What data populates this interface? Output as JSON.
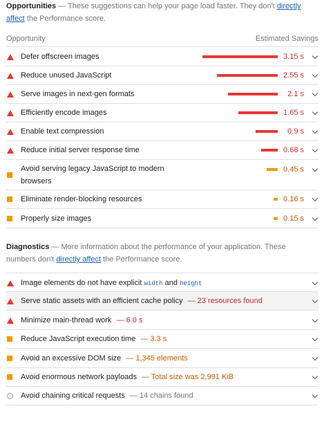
{
  "opportunities": {
    "title": "Opportunities",
    "dash": "—",
    "desc_before": "These suggestions can help your page load faster. They don't",
    "link": "directly affect",
    "desc_after": "the Performance score.",
    "col_left": "Opportunity",
    "col_right": "Estimated Savings",
    "items": [
      {
        "label": "Defer offscreen images",
        "savings": "3.15 s",
        "severity": "fail",
        "bar_fraction": 1.0
      },
      {
        "label": "Reduce unused JavaScript",
        "savings": "2.55 s",
        "severity": "fail",
        "bar_fraction": 0.81
      },
      {
        "label": "Serve images in next-gen formats",
        "savings": "2.1 s",
        "severity": "fail",
        "bar_fraction": 0.67
      },
      {
        "label": "Efficiently encode images",
        "savings": "1.65 s",
        "severity": "fail",
        "bar_fraction": 0.52
      },
      {
        "label": "Enable text compression",
        "savings": "0.9 s",
        "severity": "fail",
        "bar_fraction": 0.29
      },
      {
        "label": "Reduce initial server response time",
        "savings": "0.68 s",
        "severity": "fail",
        "bar_fraction": 0.21
      },
      {
        "label_line1": "Avoid serving legacy JavaScript to modern",
        "label_line2": "browsers",
        "savings": "0.45 s",
        "severity": "average",
        "bar_fraction": 0.14
      },
      {
        "label": "Eliminate render-blocking resources",
        "savings": "0.16 s",
        "severity": "average",
        "bar_fraction": 0.05
      },
      {
        "label": "Properly size images",
        "savings": "0.15 s",
        "severity": "average",
        "bar_fraction": 0.05
      }
    ]
  },
  "diagnostics": {
    "title": "Diagnostics",
    "dash": "—",
    "desc_line1": "More information about the performance of your application. These",
    "desc_line2_before": "numbers don't",
    "link": "directly affect",
    "desc_after": "the Performance score.",
    "items": [
      {
        "label_before": "Image elements do not have explicit",
        "code1": "width",
        "label_and": "and",
        "code2": "height",
        "severity": "fail"
      },
      {
        "label": "Serve static assets with an efficient cache policy",
        "detail": "23 resources found",
        "severity": "fail"
      },
      {
        "label": "Minimize main-thread work",
        "detail": "6.0 s",
        "severity": "fail"
      },
      {
        "label": "Reduce JavaScript execution time",
        "detail": "3.3 s",
        "severity": "average"
      },
      {
        "label": "Avoid an excessive DOM size",
        "detail": "1,345 elements",
        "severity": "average"
      },
      {
        "label": "Avoid enormous network payloads",
        "detail": "Total size was 2,991 KiB",
        "severity": "average"
      },
      {
        "label": "Avoid chaining critical requests",
        "detail": "14 chains found",
        "severity": "informative"
      }
    ]
  },
  "colors": {
    "fail": "#e53935",
    "average": "#f29900",
    "link": "#1a5fb4"
  }
}
